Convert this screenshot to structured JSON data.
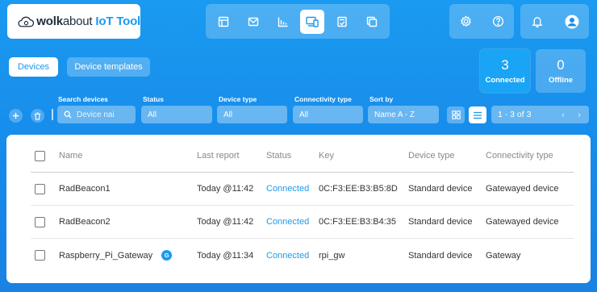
{
  "brand": {
    "name_bold": "wolk",
    "name_light": "about",
    "product": "IoT Tool"
  },
  "nav": {
    "items": [
      {
        "icon": "dashboard-icon",
        "active": false
      },
      {
        "icon": "messages-icon",
        "active": false
      },
      {
        "icon": "reports-icon",
        "active": false
      },
      {
        "icon": "devices-icon",
        "active": true
      },
      {
        "icon": "rules-icon",
        "active": false
      },
      {
        "icon": "copy-icon",
        "active": false
      }
    ]
  },
  "header_actions": [
    "gear-icon",
    "help-icon",
    "bell-icon",
    "user-icon"
  ],
  "tabs": {
    "devices": "Devices",
    "templates": "Device templates"
  },
  "stats": {
    "connected": {
      "value": "3",
      "label": "Connected"
    },
    "offline": {
      "value": "0",
      "label": "Offline"
    }
  },
  "filters": {
    "search": {
      "label": "Search devices",
      "placeholder": "Device nai"
    },
    "status": {
      "label": "Status",
      "value": "All"
    },
    "device_type": {
      "label": "Device type",
      "value": "All"
    },
    "connectivity": {
      "label": "Connectivity type",
      "value": "All"
    },
    "sort": {
      "label": "Sort by",
      "value": "Name A - Z"
    }
  },
  "pager": {
    "text": "1 - 3 of 3"
  },
  "table": {
    "columns": {
      "name": "Name",
      "last_report": "Last report",
      "status": "Status",
      "key": "Key",
      "device_type": "Device type",
      "connectivity": "Connectivity type"
    },
    "rows": [
      {
        "name": "RadBeacon1",
        "last_report": "Today @11:42",
        "status": "Connected",
        "key": "0C:F3:EE:B3:B5:8D",
        "device_type": "Standard device",
        "connectivity": "Gatewayed device",
        "gateway_badge": ""
      },
      {
        "name": "RadBeacon2",
        "last_report": "Today @11:42",
        "status": "Connected",
        "key": "0C:F3:EE:B3:B4:35",
        "device_type": "Standard device",
        "connectivity": "Gatewayed device",
        "gateway_badge": ""
      },
      {
        "name": "Raspberry_Pi_Gateway",
        "last_report": "Today @11:34",
        "status": "Connected",
        "key": "rpi_gw",
        "device_type": "Standard device",
        "connectivity": "Gateway",
        "gateway_badge": "G"
      }
    ]
  },
  "colors": {
    "accent": "#1a9af0",
    "background": "#1689ea"
  }
}
